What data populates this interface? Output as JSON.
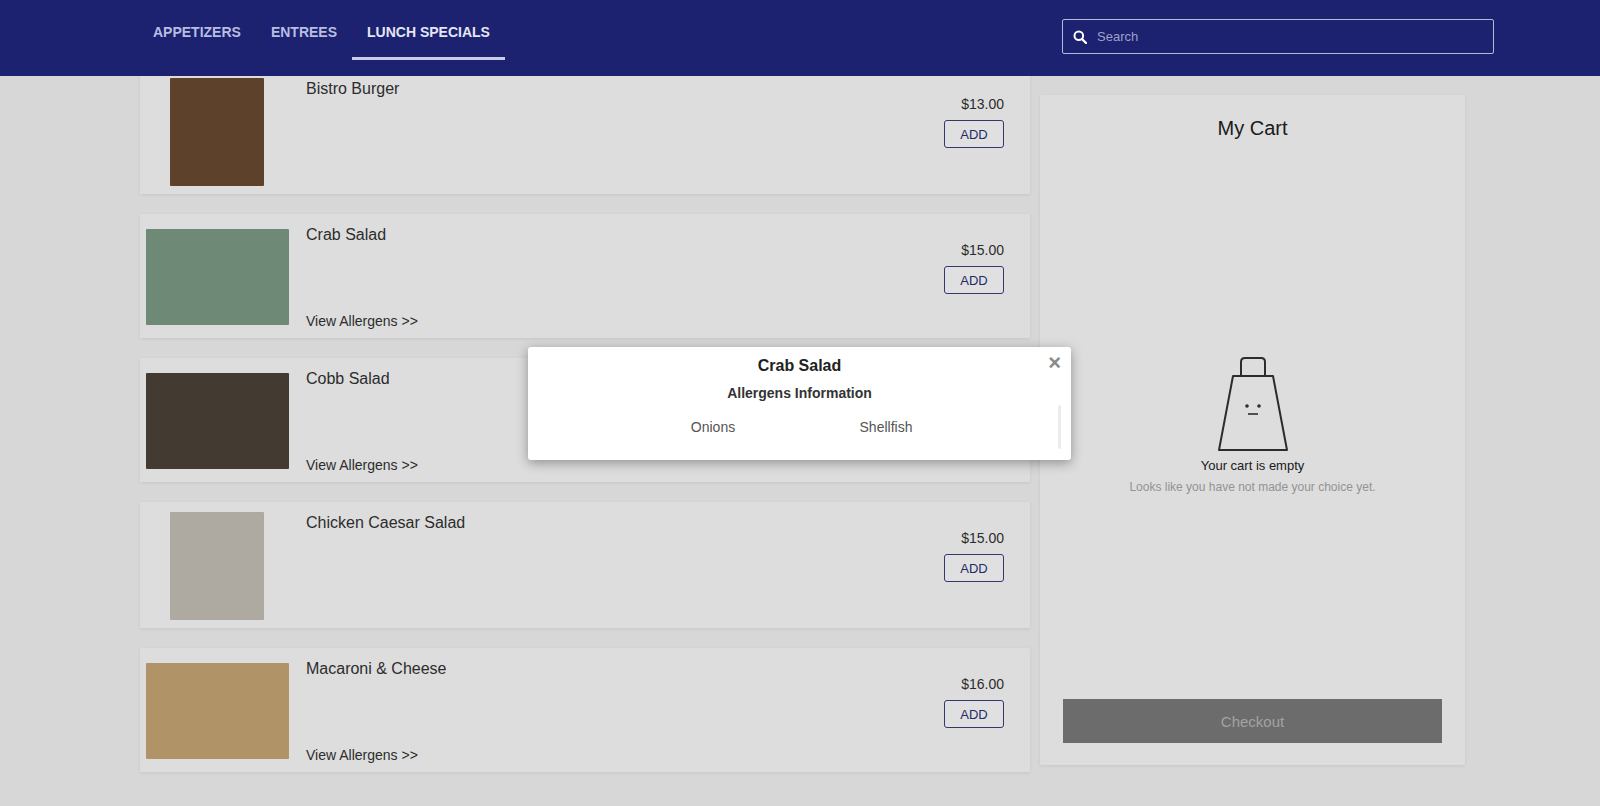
{
  "tabs": [
    {
      "label": "APPETIZERS",
      "selected": false
    },
    {
      "label": "ENTREES",
      "selected": false
    },
    {
      "label": "LUNCH SPECIALS",
      "selected": true
    }
  ],
  "search": {
    "placeholder": "Search"
  },
  "menu_items": [
    {
      "name": "Bistro Burger",
      "price": "$13.00",
      "add_label": "ADD",
      "kind": "portrait"
    },
    {
      "name": "Crab Salad",
      "price": "$15.00",
      "add_label": "ADD",
      "allergens_link": "View Allergens >>",
      "kind": "landscape"
    },
    {
      "name": "Cobb Salad",
      "allergens_link": "View Allergens >>",
      "kind": "landscape"
    },
    {
      "name": "Chicken Caesar Salad",
      "price": "$15.00",
      "add_label": "ADD",
      "kind": "portrait"
    },
    {
      "name": "Macaroni & Cheese",
      "price": "$16.00",
      "add_label": "ADD",
      "allergens_link": "View Allergens >>",
      "kind": "landscape"
    }
  ],
  "cart": {
    "title": "My Cart",
    "empty_title": "Your cart is empty",
    "empty_text": "Looks like you have not made your choice yet.",
    "checkout": {
      "label": "Checkout",
      "disabled": true
    }
  },
  "modal": {
    "title": "Crab Salad",
    "subtitle": "Allergens Information",
    "allergens": [
      "Onions",
      "Shellfish"
    ],
    "close": "×"
  }
}
